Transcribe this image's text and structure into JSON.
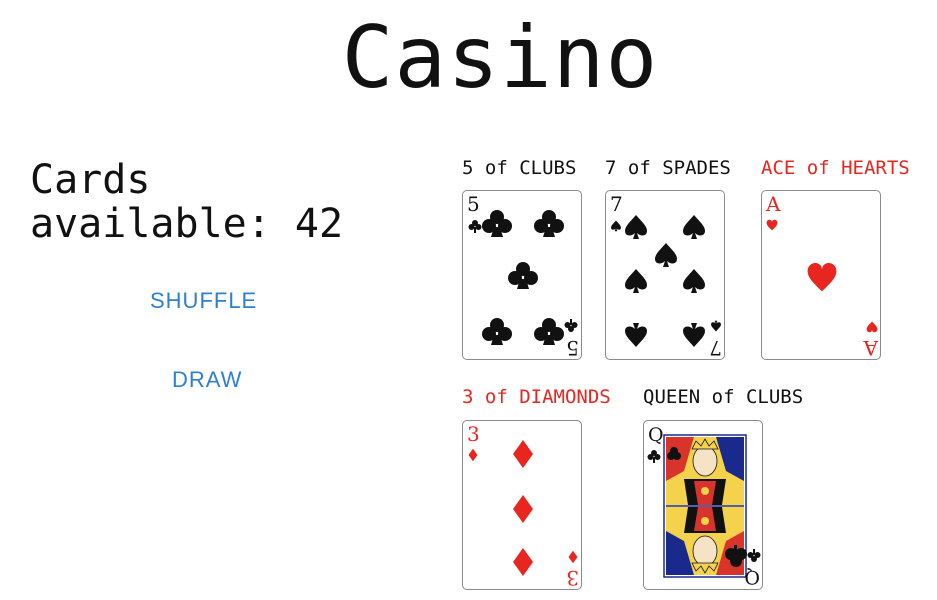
{
  "app": {
    "title": "Casino"
  },
  "deck": {
    "available_label": "Cards available:",
    "available_count": "42",
    "shuffle_label": "SHUFFLE",
    "draw_label": "DRAW"
  },
  "hand": [
    {
      "label": "5 of CLUBS",
      "rank": "5",
      "suit": "clubs",
      "color": "#111111"
    },
    {
      "label": "7 of SPADES",
      "rank": "7",
      "suit": "spades",
      "color": "#111111"
    },
    {
      "label": "ACE of HEARTS",
      "rank": "A",
      "suit": "hearts",
      "color": "#e8261f"
    },
    {
      "label": "3 of DIAMONDS",
      "rank": "3",
      "suit": "diamonds",
      "color": "#e8261f"
    },
    {
      "label": "QUEEN of CLUBS",
      "rank": "Q",
      "suit": "clubs",
      "color": "#111111"
    }
  ],
  "colors": {
    "accent": "#2f7fd0",
    "red_suit": "#e8261f",
    "black_suit": "#111111"
  }
}
